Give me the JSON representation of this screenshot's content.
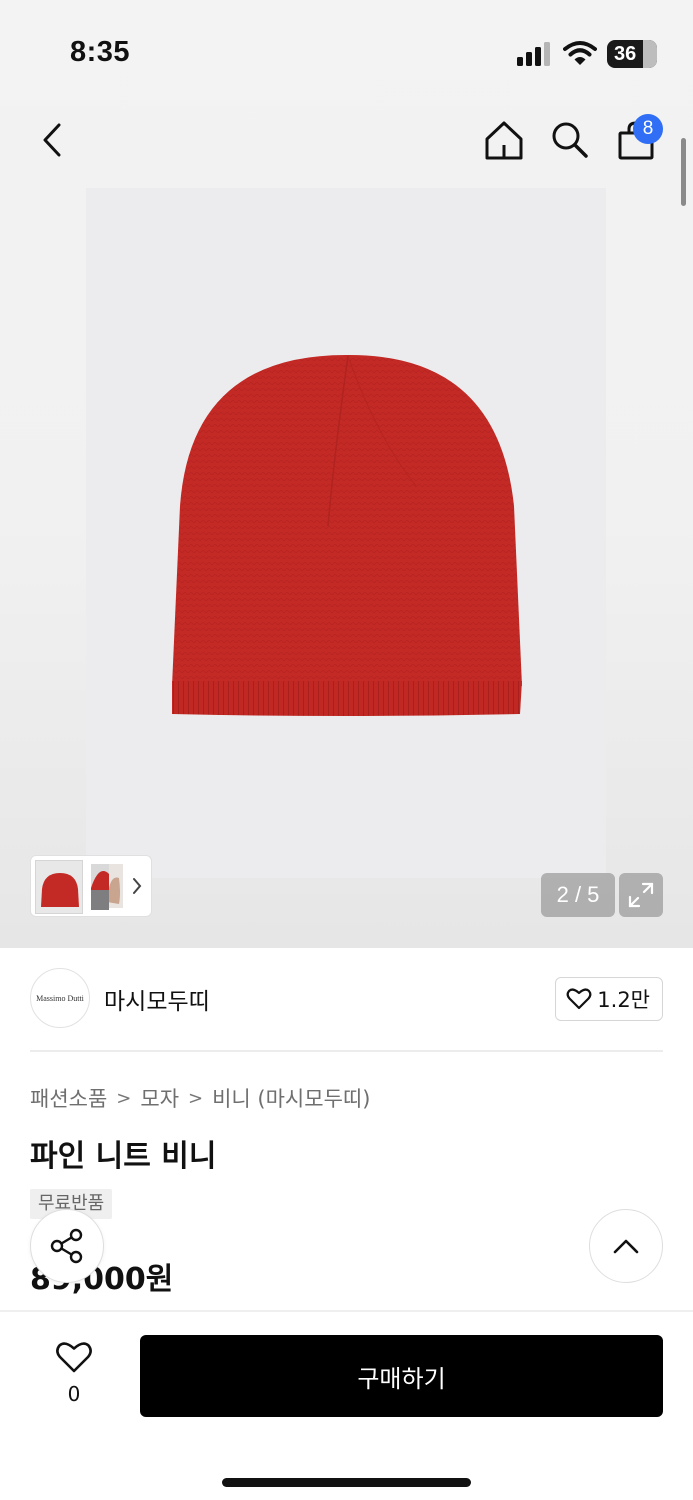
{
  "status_bar": {
    "time": "8:35",
    "battery": "36"
  },
  "nav": {
    "cart_count": "8"
  },
  "gallery": {
    "page_indicator": "2 / 5"
  },
  "brand": {
    "logo_text": "Massimo Dutti",
    "name": "마시모두띠",
    "likes": "1.2만"
  },
  "breadcrumb": [
    "패션소품",
    "모자",
    "비니 (마시모두띠)"
  ],
  "product": {
    "title": "파인 니트 비니",
    "badge": "무료반품",
    "price": "89,000원",
    "color": "#c42a25"
  },
  "bottom_bar": {
    "wish_count": "0",
    "buy_label": "구매하기"
  },
  "colors": {
    "accent_badge": "#2f6ef5",
    "buy_button": "#000000"
  },
  "icons": [
    "back-icon",
    "home-icon",
    "search-icon",
    "cart-icon",
    "expand-icon",
    "heart-icon",
    "share-icon",
    "chevron-up-icon",
    "chevron-right-icon"
  ]
}
